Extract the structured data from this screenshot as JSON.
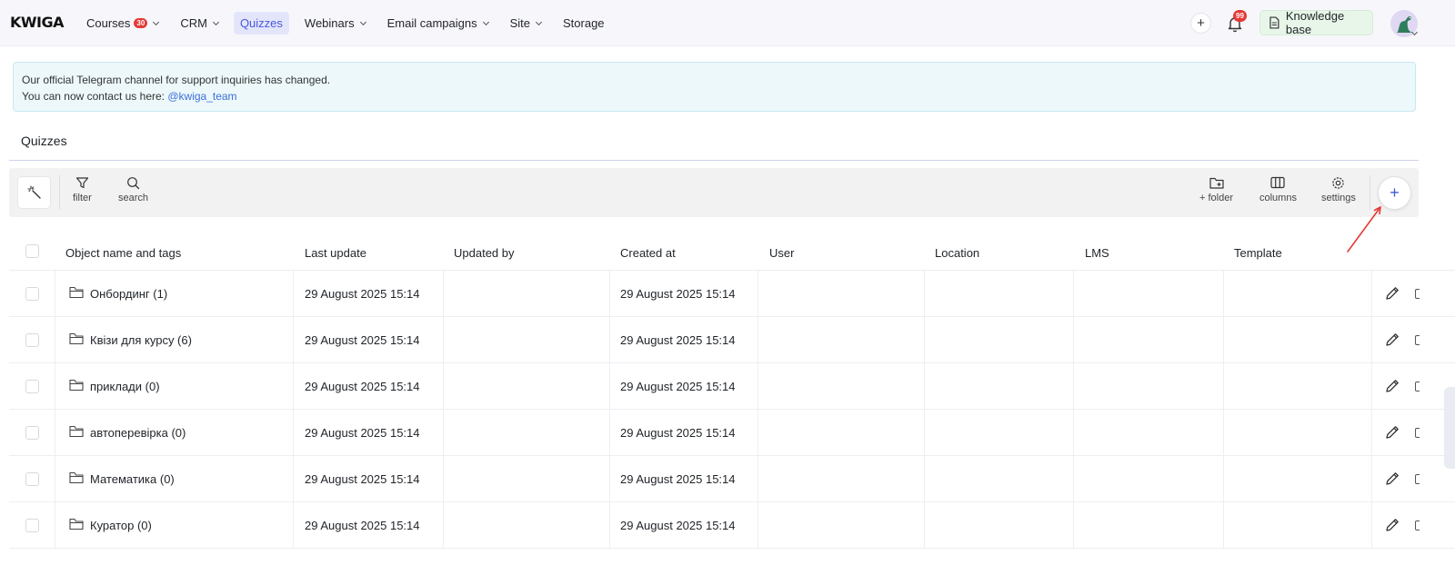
{
  "header": {
    "logo": "KWIGA",
    "nav": [
      {
        "label": "Courses",
        "badge": "30",
        "dropdown": true,
        "active": false
      },
      {
        "label": "CRM",
        "badge": null,
        "dropdown": true,
        "active": false
      },
      {
        "label": "Quizzes",
        "badge": null,
        "dropdown": false,
        "active": true
      },
      {
        "label": "Webinars",
        "badge": null,
        "dropdown": true,
        "active": false
      },
      {
        "label": "Email campaigns",
        "badge": null,
        "dropdown": true,
        "active": false
      },
      {
        "label": "Site",
        "badge": null,
        "dropdown": true,
        "active": false
      },
      {
        "label": "Storage",
        "badge": null,
        "dropdown": false,
        "active": false
      }
    ],
    "add_label": "+",
    "notifications_count": "99",
    "knowledge_base_label": "Knowledge base"
  },
  "notice": {
    "line1": "Our official Telegram channel for support inquiries has changed.",
    "line2_prefix": "You can now contact us here: ",
    "link": "@kwiga_team"
  },
  "page": {
    "title": "Quizzes"
  },
  "toolbar": {
    "filter_label": "filter",
    "search_label": "search",
    "folder_label": "+ folder",
    "columns_label": "columns",
    "settings_label": "settings",
    "add_label": "+"
  },
  "table": {
    "columns": [
      "Object name and tags",
      "Last update",
      "Updated by",
      "Created at",
      "User",
      "Location",
      "LMS",
      "Template"
    ],
    "rows": [
      {
        "name": "Онбординг (1)",
        "last_update": "29 August 2025 15:14",
        "updated_by": "",
        "created_at": "29 August 2025 15:14"
      },
      {
        "name": "Квізи для курсу (6)",
        "last_update": "29 August 2025 15:14",
        "updated_by": "",
        "created_at": "29 August 2025 15:14"
      },
      {
        "name": "приклади (0)",
        "last_update": "29 August 2025 15:14",
        "updated_by": "",
        "created_at": "29 August 2025 15:14"
      },
      {
        "name": "автоперевірка (0)",
        "last_update": "29 August 2025 15:14",
        "updated_by": "",
        "created_at": "29 August 2025 15:14"
      },
      {
        "name": "Математика (0)",
        "last_update": "29 August 2025 15:14",
        "updated_by": "",
        "created_at": "29 August 2025 15:14"
      },
      {
        "name": "Куратор (0)",
        "last_update": "29 August 2025 15:14",
        "updated_by": "",
        "created_at": "29 August 2025 15:14"
      }
    ]
  },
  "colors": {
    "accent": "#4a59d8",
    "badge_red": "#e53935",
    "notice_bg": "#edf8fb",
    "knowledge_base_bg": "#e8f5e9",
    "annotation_arrow": "#e53935"
  }
}
